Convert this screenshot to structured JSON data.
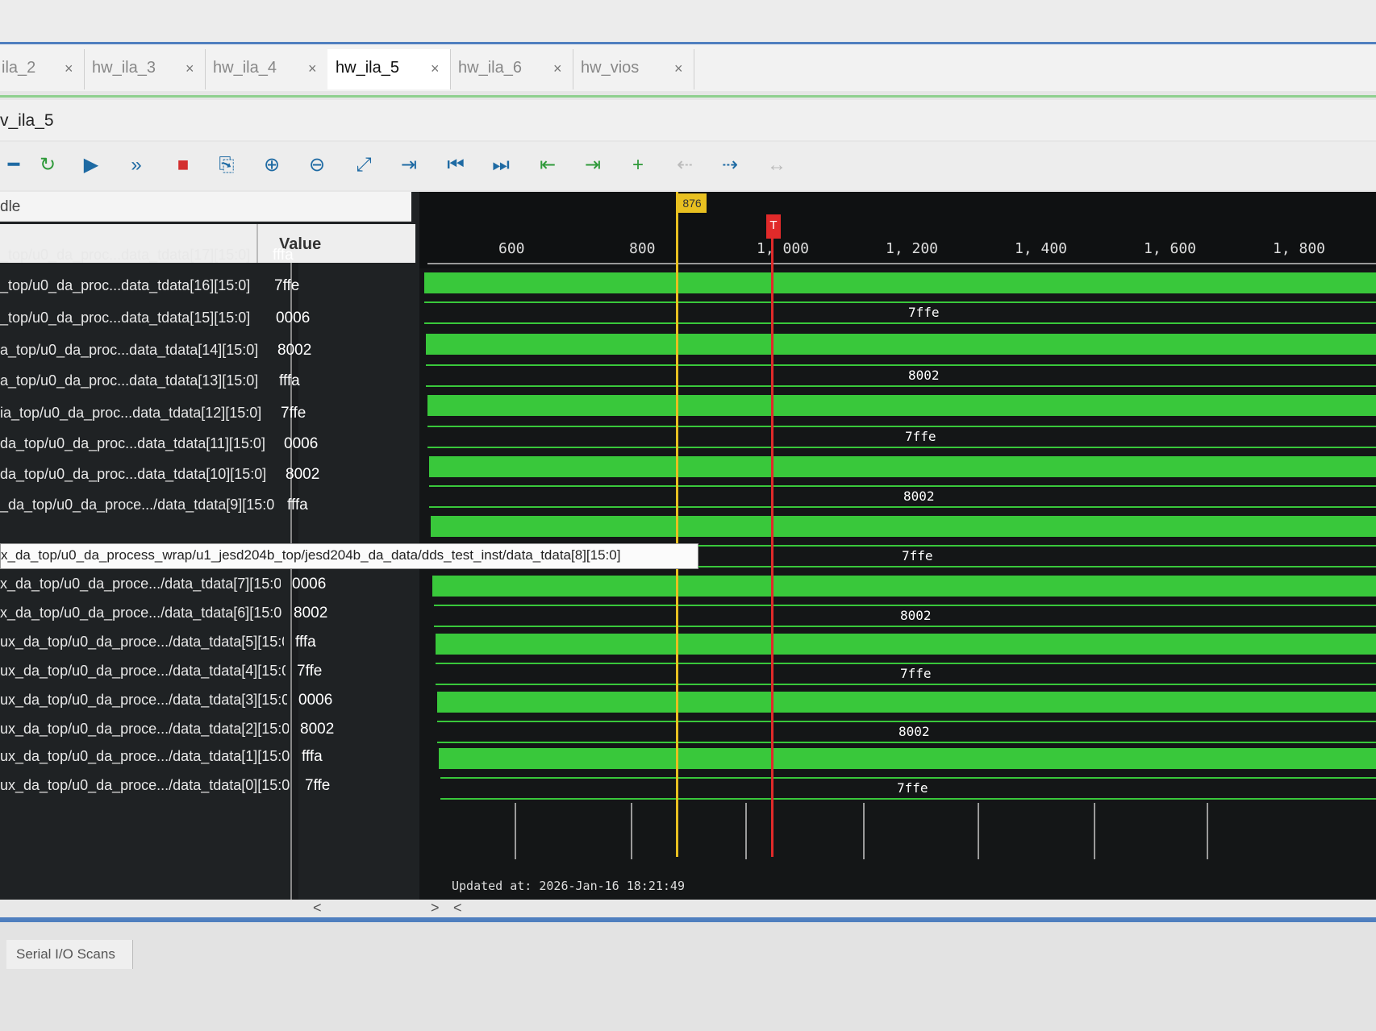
{
  "tabs": [
    {
      "label": "ila_2",
      "close": "×"
    },
    {
      "label": "hw_ila_3",
      "close": "×"
    },
    {
      "label": "hw_ila_4",
      "close": "×"
    },
    {
      "label": "hw_ila_5",
      "close": "×"
    },
    {
      "label": "hw_ila_6",
      "close": "×"
    },
    {
      "label": "hw_vios",
      "close": "×"
    }
  ],
  "window": {
    "title": "v_ila_5"
  },
  "toolbar": {
    "icons": [
      "collapse-icon",
      "refresh-icon",
      "run-trigger-icon",
      "run-immediate-icon",
      "stop-icon",
      "export-icon",
      "zoom-in-icon",
      "zoom-out-icon",
      "zoom-fit-icon",
      "goto-cursor-icon",
      "go-first-icon",
      "go-last-icon",
      "prev-transition-icon",
      "next-transition-icon",
      "add-marker-icon",
      "prev-marker-icon",
      "next-marker-icon",
      "swap-cursors-icon"
    ]
  },
  "signal_panel": {
    "filter_label": "dle",
    "value_header": "Value"
  },
  "signals": [
    {
      "name": "_top/u0_da_proc...data_tdata[17][15:0]",
      "value": "fffa"
    },
    {
      "name": "_top/u0_da_proc...data_tdata[16][15:0]",
      "value": "7ffe"
    },
    {
      "name": "_top/u0_da_proc...data_tdata[15][15:0]",
      "value": "0006"
    },
    {
      "name": "a_top/u0_da_proc...data_tdata[14][15:0]",
      "value": "8002"
    },
    {
      "name": "a_top/u0_da_proc...data_tdata[13][15:0]",
      "value": "fffa"
    },
    {
      "name": "ia_top/u0_da_proc...data_tdata[12][15:0]",
      "value": "7ffe"
    },
    {
      "name": "da_top/u0_da_proc...data_tdata[11][15:0]",
      "value": "0006"
    },
    {
      "name": "da_top/u0_da_proc...data_tdata[10][15:0]",
      "value": "8002"
    },
    {
      "name": "_da_top/u0_da_proce.../data_tdata[9][15:0",
      "value": "fffa"
    },
    {
      "name": "x_da_top/u0_da_process_wrap/u1_jesd204b_top/jesd204b_da_data/dds_test_inst/data_tdata[8][15:0]",
      "value": ""
    },
    {
      "name": "x_da_top/u0_da_proce.../data_tdata[7][15:0",
      "value": "0006"
    },
    {
      "name": "x_da_top/u0_da_proce.../data_tdata[6][15:0",
      "value": "8002"
    },
    {
      "name": "ux_da_top/u0_da_proce.../data_tdata[5][15:0",
      "value": "fffa"
    },
    {
      "name": "ux_da_top/u0_da_proce.../data_tdata[4][15:0",
      "value": "7ffe"
    },
    {
      "name": "ux_da_top/u0_da_proce.../data_tdata[3][15:0",
      "value": "0006"
    },
    {
      "name": "ux_da_top/u0_da_proce.../data_tdata[2][15:0",
      "value": "8002"
    },
    {
      "name": "ux_da_top/u0_da_proce.../data_tdata[1][15:0",
      "value": "fffa"
    },
    {
      "name": "ux_da_top/u0_da_proce.../data_tdata[0][15:0",
      "value": "7ffe"
    }
  ],
  "tooltip": "x_da_top/u0_da_process_wrap/u1_jesd204b_top/jesd204b_da_data/dds_test_inst/data_tdata[8][15:0]",
  "ruler": {
    "labels": [
      "600",
      "800",
      "1, 000",
      "1, 200",
      "1, 400",
      "1, 600",
      "1, 800"
    ]
  },
  "cursors": {
    "yellow_label": "876",
    "trigger_label": "T"
  },
  "bus_values": [
    "7ffe",
    "8002",
    "7ffe",
    "8002",
    "7ffe",
    "8002",
    "7ffe",
    "8002",
    "7ffe"
  ],
  "status": {
    "updated": "Updated at: 2026-Jan-16 18:21:49"
  },
  "footer": {
    "tab": "Serial I/O Scans"
  },
  "colors": {
    "waveform": "#39c83b",
    "cursor_yellow": "#e8c020",
    "cursor_red": "#e12a2a",
    "accent": "#4f7fbf"
  }
}
